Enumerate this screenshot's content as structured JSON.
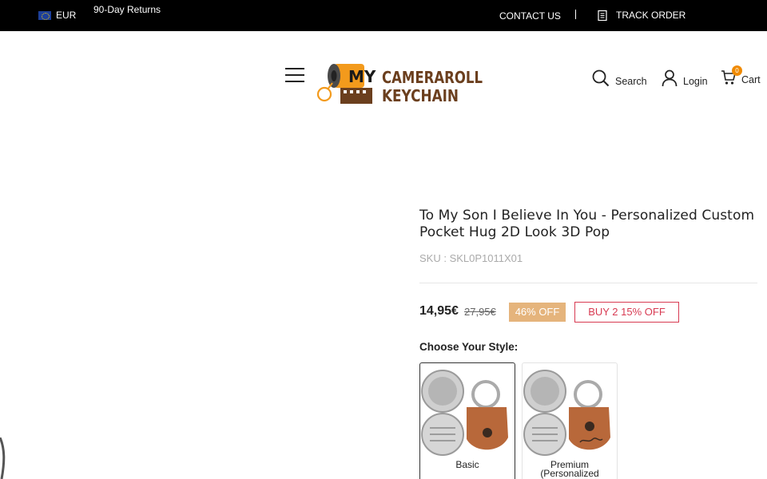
{
  "topbar": {
    "currency": "EUR",
    "returns": "90-Day Returns",
    "contact": "CONTACT US",
    "track": "TRACK ORDER"
  },
  "header": {
    "logo_line1": "MY",
    "logo_line2": "CAMERAROLL",
    "logo_line3": "KEYCHAIN",
    "search_label": "Search",
    "login_label": "Login",
    "cart_label": "Cart",
    "cart_count": "0"
  },
  "product": {
    "title": "To My Son I Believe In You - Personalized Custom Pocket Hug 2D Look 3D Pop",
    "sku": "SKU : SKL0P1011X01",
    "price": "14,95€",
    "old_price": "27,95€",
    "discount_badge": "46% OFF",
    "bundle_offer": "BUY 2 15% OFF",
    "style_label": "Choose Your Style:",
    "options": [
      {
        "label": "Basic",
        "selected": true
      },
      {
        "label": "Premium (Personalized",
        "selected": false
      }
    ]
  },
  "colors": {
    "topbar_bg": "#000000",
    "badge_bg": "#e5b47c",
    "offer_border": "#d83a52",
    "cart_badge": "#f08a00",
    "logo_orange": "#f39a1c",
    "logo_brown": "#6b3f1e"
  }
}
